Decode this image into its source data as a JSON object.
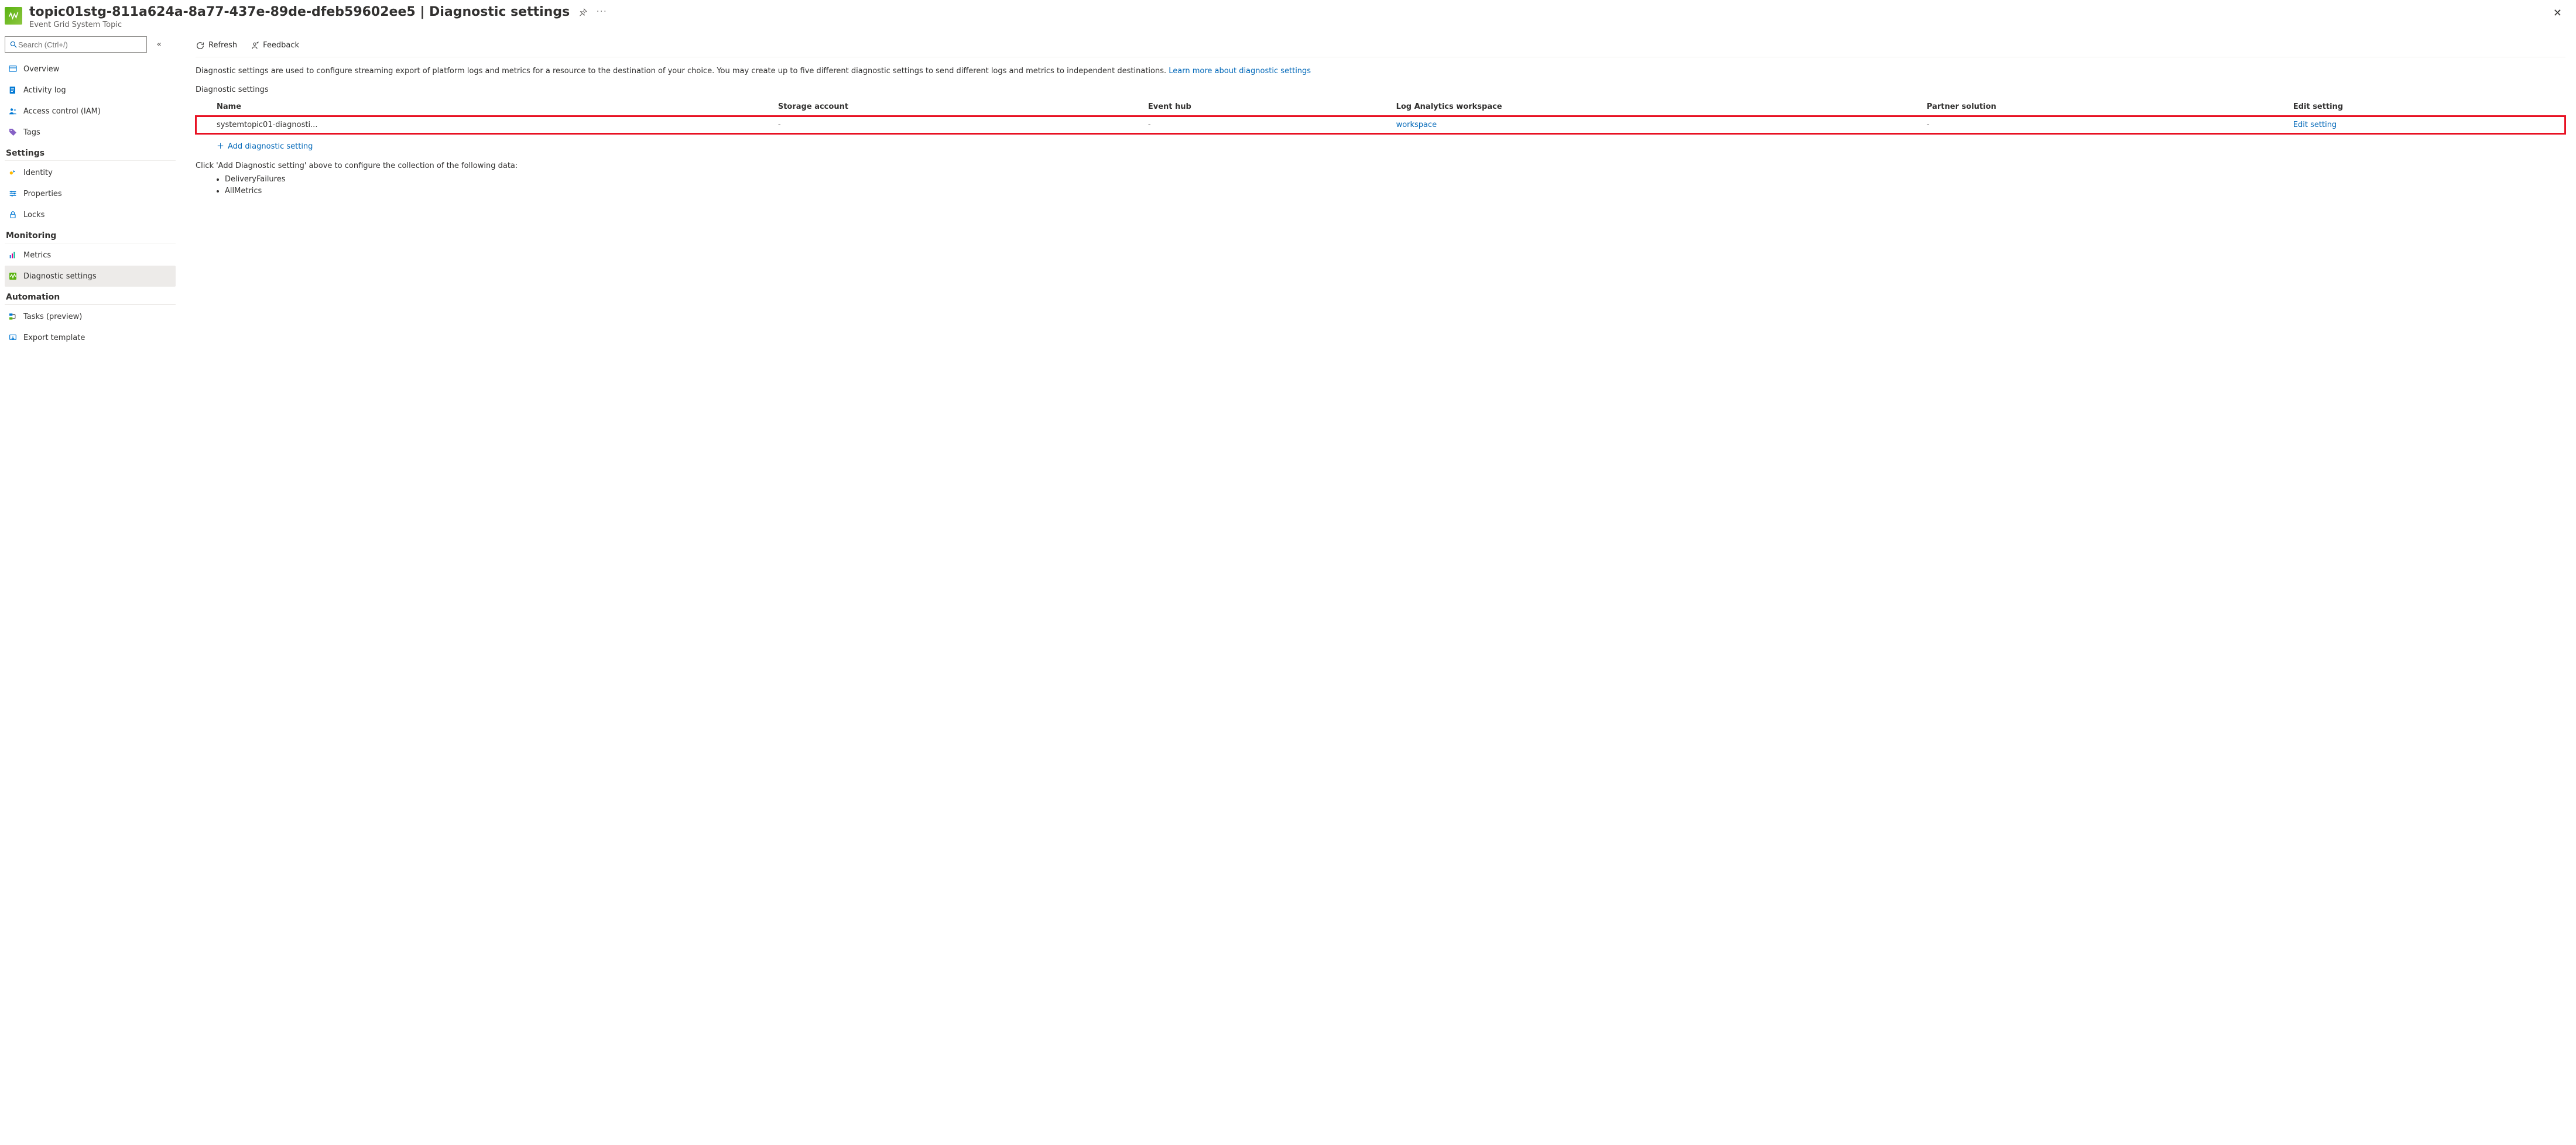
{
  "header": {
    "title": "topic01stg-811a624a-8a77-437e-89de-dfeb59602ee5 | Diagnostic settings",
    "subtitle": "Event Grid System Topic"
  },
  "search": {
    "placeholder": "Search (Ctrl+/)"
  },
  "nav": {
    "top": [
      {
        "key": "overview",
        "label": "Overview"
      },
      {
        "key": "activity-log",
        "label": "Activity log"
      },
      {
        "key": "access-control",
        "label": "Access control (IAM)"
      },
      {
        "key": "tags",
        "label": "Tags"
      }
    ],
    "sections": [
      {
        "title": "Settings",
        "items": [
          {
            "key": "identity",
            "label": "Identity"
          },
          {
            "key": "properties",
            "label": "Properties"
          },
          {
            "key": "locks",
            "label": "Locks"
          }
        ]
      },
      {
        "title": "Monitoring",
        "items": [
          {
            "key": "metrics",
            "label": "Metrics"
          },
          {
            "key": "diagnostic-settings",
            "label": "Diagnostic settings",
            "selected": true
          }
        ]
      },
      {
        "title": "Automation",
        "items": [
          {
            "key": "tasks",
            "label": "Tasks (preview)"
          },
          {
            "key": "export-template",
            "label": "Export template"
          }
        ]
      }
    ]
  },
  "commands": {
    "refresh": "Refresh",
    "feedback": "Feedback"
  },
  "main": {
    "description": "Diagnostic settings are used to configure streaming export of platform logs and metrics for a resource to the destination of your choice. You may create up to five different diagnostic settings to send different logs and metrics to independent destinations. ",
    "learn_more": "Learn more about diagnostic settings",
    "section_label": "Diagnostic settings",
    "columns": {
      "name": "Name",
      "storage": "Storage account",
      "eventhub": "Event hub",
      "law": "Log Analytics workspace",
      "partner": "Partner solution",
      "edit": "Edit setting"
    },
    "rows": [
      {
        "name": "systemtopic01-diagnosti...",
        "storage": "-",
        "eventhub": "-",
        "law": "workspace",
        "partner": "-",
        "edit": "Edit setting"
      }
    ],
    "add_label": "Add diagnostic setting",
    "hint_intro": "Click 'Add Diagnostic setting' above to configure the collection of the following data:",
    "hint_items": [
      "DeliveryFailures",
      "AllMetrics"
    ]
  }
}
